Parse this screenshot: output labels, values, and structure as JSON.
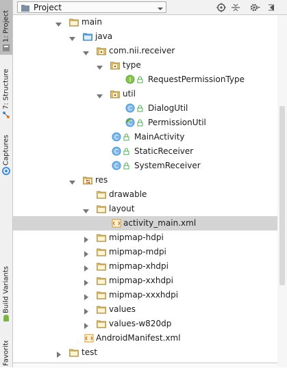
{
  "header": {
    "project_label": "Project",
    "icons": [
      "target-icon",
      "collapse-icon",
      "gear-icon",
      "hide-icon"
    ]
  },
  "side_tabs": [
    {
      "label": "1: Project",
      "active": true,
      "icon": "project-icon"
    },
    {
      "label": "7: Structure",
      "active": false,
      "icon": "structure-icon"
    },
    {
      "label": "Captures",
      "active": false,
      "icon": "captures-icon"
    },
    {
      "label": "Build Variants",
      "active": false,
      "icon": "android-icon"
    },
    {
      "label": "Favorites",
      "active": false,
      "icon": "star-icon"
    }
  ],
  "tree": [
    {
      "label": "main",
      "kind": "folder",
      "expanded": true
    },
    {
      "label": "java",
      "kind": "source-folder",
      "expanded": true
    },
    {
      "label": "com.nii.receiver",
      "kind": "package",
      "expanded": true
    },
    {
      "label": "type",
      "kind": "package",
      "expanded": true
    },
    {
      "label": "RequestPermissionType",
      "kind": "interface"
    },
    {
      "label": "util",
      "kind": "package",
      "expanded": true
    },
    {
      "label": "DialogUtil",
      "kind": "class"
    },
    {
      "label": "PermissionUtil",
      "kind": "class"
    },
    {
      "label": "MainActivity",
      "kind": "class"
    },
    {
      "label": "StaticReceiver",
      "kind": "class"
    },
    {
      "label": "SystemReceiver",
      "kind": "class"
    },
    {
      "label": "res",
      "kind": "res-folder",
      "expanded": true
    },
    {
      "label": "drawable",
      "kind": "folder"
    },
    {
      "label": "layout",
      "kind": "folder",
      "expanded": true
    },
    {
      "label": "activity_main.xml",
      "kind": "xml",
      "selected": true
    },
    {
      "label": "mipmap-hdpi",
      "kind": "folder",
      "expanded": false
    },
    {
      "label": "mipmap-mdpi",
      "kind": "folder",
      "expanded": false
    },
    {
      "label": "mipmap-xhdpi",
      "kind": "folder",
      "expanded": false
    },
    {
      "label": "mipmap-xxhdpi",
      "kind": "folder",
      "expanded": false
    },
    {
      "label": "mipmap-xxxhdpi",
      "kind": "folder",
      "expanded": false
    },
    {
      "label": "values",
      "kind": "folder",
      "expanded": false
    },
    {
      "label": "values-w820dp",
      "kind": "folder",
      "expanded": false
    },
    {
      "label": "AndroidManifest.xml",
      "kind": "manifest"
    },
    {
      "label": "test",
      "kind": "folder",
      "expanded": false
    }
  ],
  "colors": {
    "folder": "#d9b96c",
    "source_folder": "#6aa7d9",
    "class": "#3f8fd6",
    "interface": "#5aa84a",
    "lock": "#4caf50",
    "selected": "#d4d4d4"
  }
}
